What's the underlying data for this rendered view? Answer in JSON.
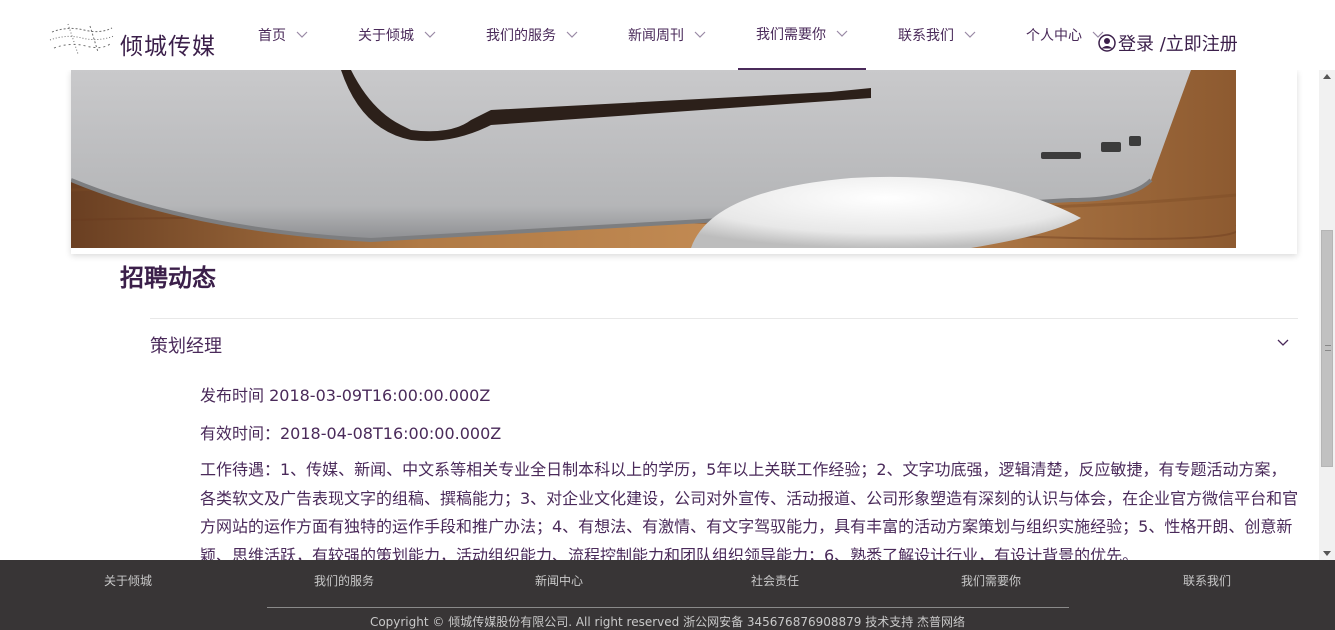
{
  "header": {
    "logo_text": "倾城传媒",
    "nav": [
      {
        "label": "首页",
        "active": false
      },
      {
        "label": "关于倾城",
        "active": false
      },
      {
        "label": "我们的服务",
        "active": false
      },
      {
        "label": "新闻周刊",
        "active": false
      },
      {
        "label": "我们需要你",
        "active": true
      },
      {
        "label": "联系我们",
        "active": false
      },
      {
        "label": "个人中心",
        "active": false
      }
    ],
    "login_text": "登录 /立即注册",
    "accent_color": "#4a2a5a"
  },
  "section": {
    "title": "招聘动态"
  },
  "job": {
    "title": "策划经理",
    "published": "发布时间 2018-03-09T16:00:00.000Z",
    "valid": "有效时间：2018-04-08T16:00:00.000Z",
    "description": "工作待遇：1、传媒、新闻、中文系等相关专业全日制本科以上的学历，5年以上关联工作经验；2、文字功底强，逻辑清楚，反应敏捷，有专题活动方案，各类软文及广告表现文字的组稿、撰稿能力；3、对企业文化建设，公司对外宣传、活动报道、公司形象塑造有深刻的认识与体会，在企业官方微信平台和官方网站的运作方面有独特的运作手段和推广办法；4、有想法、有激情、有文字驾驭能力，具有丰富的活动方案策划与组织实施经验；5、性格开朗、创意新颖、思维活跃，有较强的策划能力，活动组织能力、流程控制能力和团队组织领导能力；6、熟悉了解设计行业，有设计背景的优先。"
  },
  "footer": {
    "links": [
      "关于倾城",
      "我们的服务",
      "新闻中心",
      "社会责任",
      "我们需要你",
      "联系我们"
    ],
    "copyright": "Copyright © 倾城传媒股份有限公司. All right reserved  浙公网安备 345676876908879 技术支持 杰普网络",
    "background": "#383536"
  },
  "icons": {
    "nav_chevron": "chevron-down-icon",
    "user": "user-circle-icon",
    "logo": "logo-icon"
  }
}
